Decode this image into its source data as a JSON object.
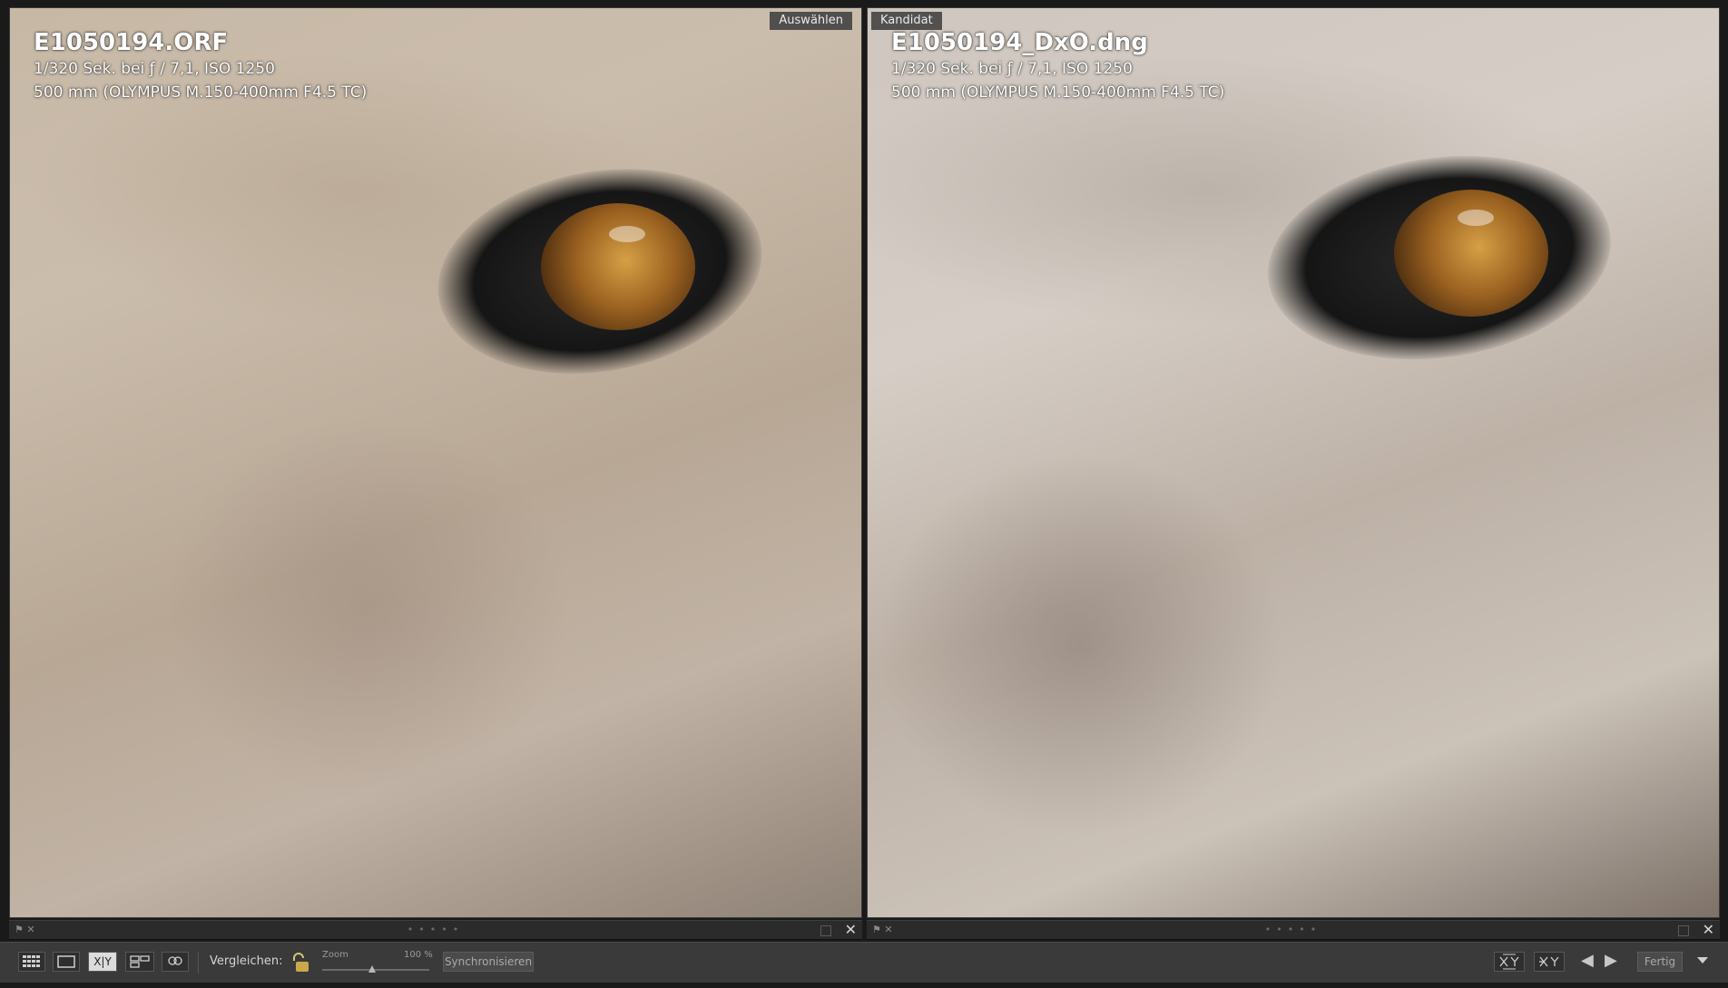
{
  "left_pane": {
    "badge": "Auswählen",
    "filename": "E1050194.ORF",
    "exif_exposure": "1/320 Sek. bei ƒ / 7,1, ISO 1250",
    "exif_lens": "500 mm (OLYMPUS M.150-400mm F4.5 TC)"
  },
  "right_pane": {
    "badge": "Kandidat",
    "filename": "E1050194_DxO.dng",
    "exif_exposure": "1/320 Sek. bei ƒ / 7,1, ISO 1250",
    "exif_lens": "500 mm (OLYMPUS M.150-400mm F4.5 TC)"
  },
  "toolbar": {
    "compare_label": "Vergleichen:",
    "zoom_label": "Zoom",
    "zoom_value": "100 %",
    "sync_label": "Synchronisieren",
    "done_label": "Fertig",
    "xy_label": "X|Y",
    "zoom_level": 0.47
  },
  "icons": {
    "grid": "grid-view-icon",
    "loupe": "loupe-view-icon",
    "compare": "compare-view-icon",
    "survey": "survey-view-icon",
    "people": "people-view-icon",
    "lock": "lock-icon",
    "swap": "swap-icon",
    "make_select": "make-select-icon",
    "prev": "arrow-left-icon",
    "next": "arrow-right-icon",
    "dropdown": "chevron-down-icon"
  }
}
